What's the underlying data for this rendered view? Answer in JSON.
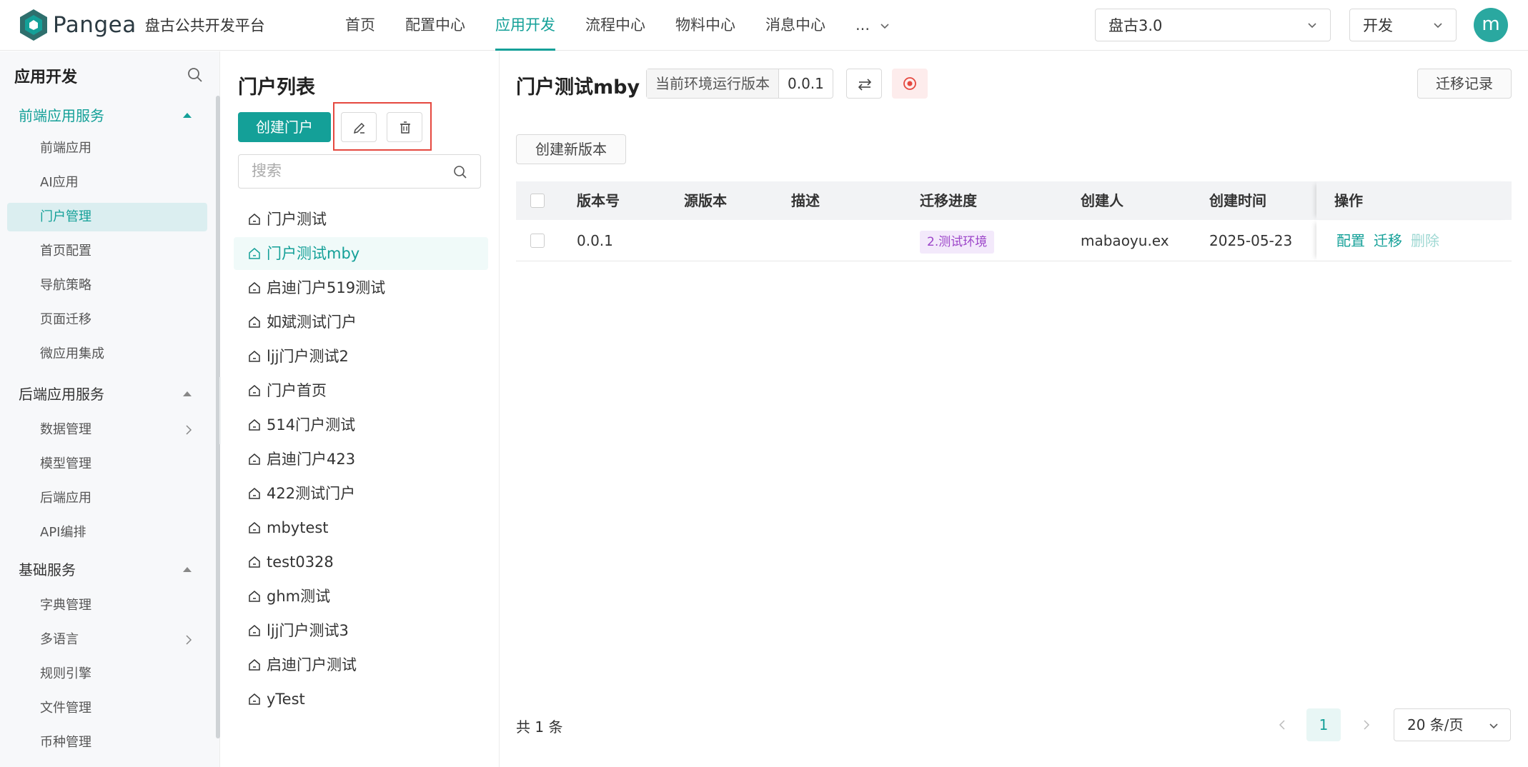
{
  "brand": {
    "name": "Pangea",
    "subtitle": "盘古公共开发平台"
  },
  "nav": {
    "items": [
      {
        "label": "首页"
      },
      {
        "label": "配置中心"
      },
      {
        "label": "应用开发",
        "active": true
      },
      {
        "label": "流程中心"
      },
      {
        "label": "物料中心"
      },
      {
        "label": "消息中心"
      },
      {
        "label": "..."
      }
    ]
  },
  "header": {
    "project_select": "盘古3.0",
    "env_select": "开发",
    "avatar_initial": "m"
  },
  "sidebar": {
    "title": "应用开发",
    "groups": [
      {
        "label": "前端应用服务",
        "items": [
          "前端应用",
          "AI应用",
          "门户管理",
          "首页配置",
          "导航策略",
          "页面迁移",
          "微应用集成"
        ]
      },
      {
        "label": "后端应用服务",
        "items": [
          "数据管理",
          "模型管理",
          "后端应用",
          "API编排"
        ]
      },
      {
        "label": "基础服务",
        "items": [
          "字典管理",
          "多语言",
          "规则引擎",
          "文件管理",
          "币种管理"
        ]
      }
    ],
    "active_item": "门户管理"
  },
  "portal_list": {
    "title": "门户列表",
    "create_label": "创建门户",
    "search_placeholder": "搜索",
    "items": [
      "门户测试",
      "门户测试mby",
      "启迪门户519测试",
      "如斌测试门户",
      "ljj门户测试2",
      "门户首页",
      "514门户测试",
      "启迪门户423",
      "422测试门户",
      "mbytest",
      "test0328",
      "ghm测试",
      "ljj门户测试3",
      "启迪门户测试",
      "yTest"
    ],
    "active_item": "门户测试mby"
  },
  "main": {
    "title": "门户测试mby",
    "env_version_label": "当前环境运行版本",
    "env_version_value": "0.0.1",
    "migration_log_label": "迁移记录",
    "create_version_label": "创建新版本",
    "columns": [
      "版本号",
      "源版本",
      "描述",
      "迁移进度",
      "创建人",
      "创建时间",
      "操作"
    ],
    "rows": [
      {
        "version": "0.0.1",
        "source": "",
        "desc": "",
        "progress": "2.测试环境",
        "creator": "mabaoyu.ex",
        "created": "2025-05-23",
        "actions": [
          "配置",
          "迁移",
          "删除"
        ]
      }
    ],
    "total_text": "共 1 条",
    "page": "1",
    "page_size": "20 条/页"
  },
  "colors": {
    "accent": "#14a098",
    "highlight_box": "#e5483f",
    "stage_tag_bg": "#f3e9fb",
    "stage_tag_text": "#9c45c9"
  }
}
